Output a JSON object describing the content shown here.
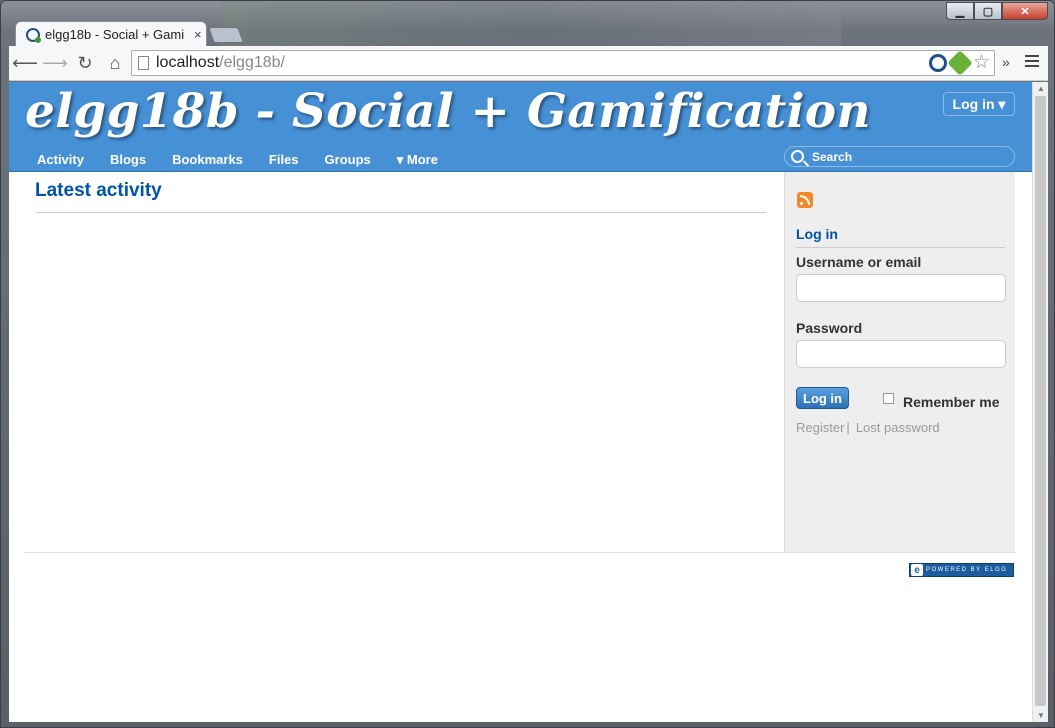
{
  "browser": {
    "tab_title": "elgg18b - Social + Gami",
    "tab_close": "×",
    "url_host": "localhost",
    "url_path": "/elgg18b/",
    "overflow_chevron": "»"
  },
  "site": {
    "title": "elgg18b - Social + Gamification",
    "login_dropdown": "Log in ▾",
    "menu": [
      {
        "label": "Activity"
      },
      {
        "label": "Blogs"
      },
      {
        "label": "Bookmarks"
      },
      {
        "label": "Files"
      },
      {
        "label": "Groups"
      },
      {
        "label": "▾ More"
      }
    ],
    "search_placeholder": "Search"
  },
  "main": {
    "heading": "Latest activity"
  },
  "sidebar": {
    "login_heading": "Log in",
    "username_label": "Username or email",
    "password_label": "Password",
    "login_button": "Log in",
    "remember_label": "Remember me",
    "register_link": "Register",
    "separator": "|",
    "lost_password_link": "Lost password"
  },
  "footer": {
    "powered_text": "POWERED BY ELGG"
  },
  "colors": {
    "header_blue": "#4690d6",
    "heading_blue": "#0054a7",
    "sidebar_gray": "#eeeeee"
  }
}
